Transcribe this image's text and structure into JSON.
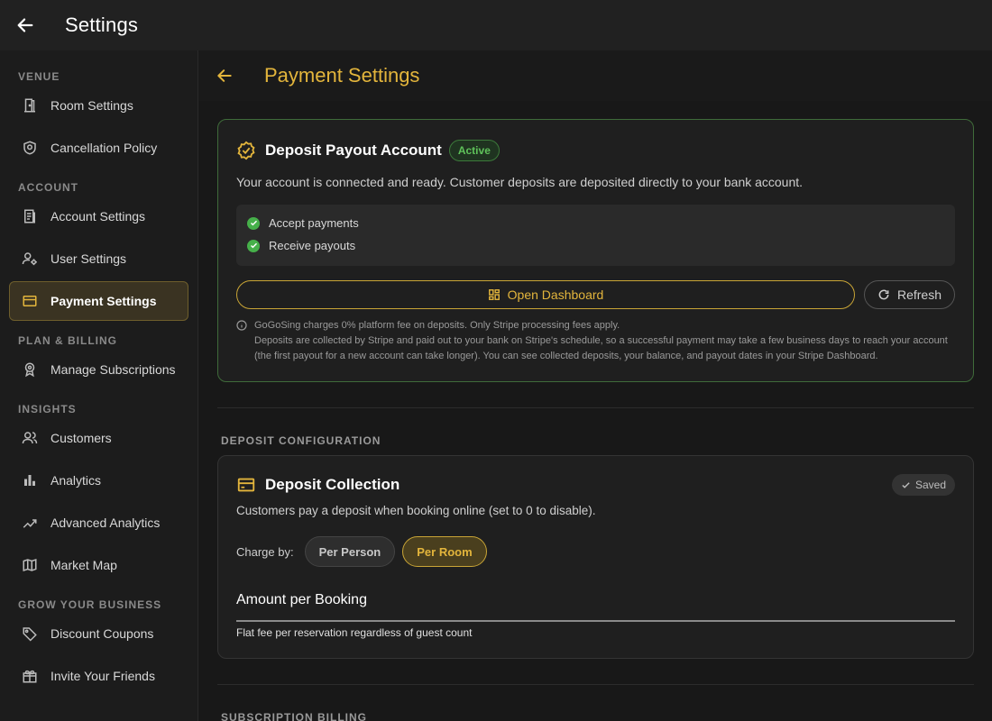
{
  "app": {
    "title": "Settings"
  },
  "sidebar": {
    "sections": [
      {
        "label": "VENUE",
        "items": [
          {
            "label": "Room Settings",
            "icon": "door-icon"
          },
          {
            "label": "Cancellation Policy",
            "icon": "shield-icon"
          }
        ]
      },
      {
        "label": "ACCOUNT",
        "items": [
          {
            "label": "Account Settings",
            "icon": "receipt-icon"
          },
          {
            "label": "User Settings",
            "icon": "user-cog-icon"
          },
          {
            "label": "Payment Settings",
            "icon": "credit-card-icon",
            "active": true
          }
        ]
      },
      {
        "label": "PLAN & BILLING",
        "items": [
          {
            "label": "Manage Subscriptions",
            "icon": "award-icon"
          }
        ]
      },
      {
        "label": "INSIGHTS",
        "items": [
          {
            "label": "Customers",
            "icon": "users-icon"
          },
          {
            "label": "Analytics",
            "icon": "bar-chart-icon"
          },
          {
            "label": "Advanced Analytics",
            "icon": "trending-icon"
          },
          {
            "label": "Market Map",
            "icon": "map-icon"
          }
        ]
      },
      {
        "label": "GROW YOUR BUSINESS",
        "items": [
          {
            "label": "Discount Coupons",
            "icon": "tag-icon"
          },
          {
            "label": "Invite Your Friends",
            "icon": "gift-icon"
          }
        ]
      }
    ]
  },
  "page": {
    "title": "Payment Settings"
  },
  "payout": {
    "title": "Deposit Payout Account",
    "badge": "Active",
    "description": "Your account is connected and ready. Customer deposits are deposited directly to your bank account.",
    "checks": [
      "Accept payments",
      "Receive payouts"
    ],
    "dashboard_label": "Open Dashboard",
    "refresh_label": "Refresh",
    "note_line1": "GoGoSing charges 0% platform fee on deposits. Only Stripe processing fees apply.",
    "note_line2": "Deposits are collected by Stripe and paid out to your bank on Stripe's schedule, so a successful payment may take a few business days to reach your account (the first payout for a new account can take longer). You can see collected deposits, your balance, and payout dates in your Stripe Dashboard."
  },
  "deposit_config": {
    "section_label": "DEPOSIT CONFIGURATION",
    "title": "Deposit Collection",
    "saved_label": "Saved",
    "description": "Customers pay a deposit when booking online (set to 0 to disable).",
    "charge_by_label": "Charge by:",
    "options": [
      "Per Person",
      "Per Room"
    ],
    "selected": "Per Room",
    "amount_label": "Amount per Booking",
    "amount_value": "",
    "amount_helper": "Flat fee per reservation regardless of guest count"
  },
  "subscription": {
    "section_label": "SUBSCRIPTION BILLING"
  },
  "colors": {
    "accent": "#e3b53c",
    "success": "#46b04a",
    "background": "#181818"
  }
}
